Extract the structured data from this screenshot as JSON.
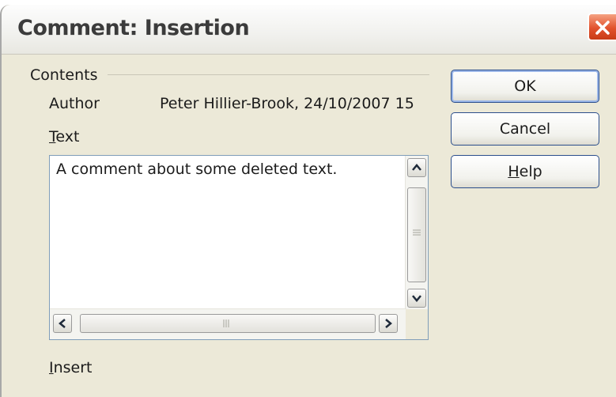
{
  "window": {
    "title": "Comment: Insertion"
  },
  "contents": {
    "group_label": "Contents",
    "author_label": "Author",
    "author_value": "Peter Hillier-Brook, 24/10/2007 15",
    "text_label_prefix": "",
    "text_label_mnemonic": "T",
    "text_label_rest": "ext",
    "text_value": "A comment about some deleted text."
  },
  "footer": {
    "insert_label_mnemonic": "I",
    "insert_label_rest": "nsert"
  },
  "buttons": {
    "ok": "OK",
    "cancel": "Cancel",
    "help_mnemonic": "H",
    "help_rest": "elp"
  },
  "icons": [
    "close-icon",
    "scroll-up-icon",
    "scroll-down-icon",
    "scroll-left-icon",
    "scroll-right-icon",
    "grip-icon"
  ],
  "colors": {
    "close_button": "#e2522d",
    "button_border": "#2b4e8c",
    "dialog_bg": "#ece9d8"
  }
}
